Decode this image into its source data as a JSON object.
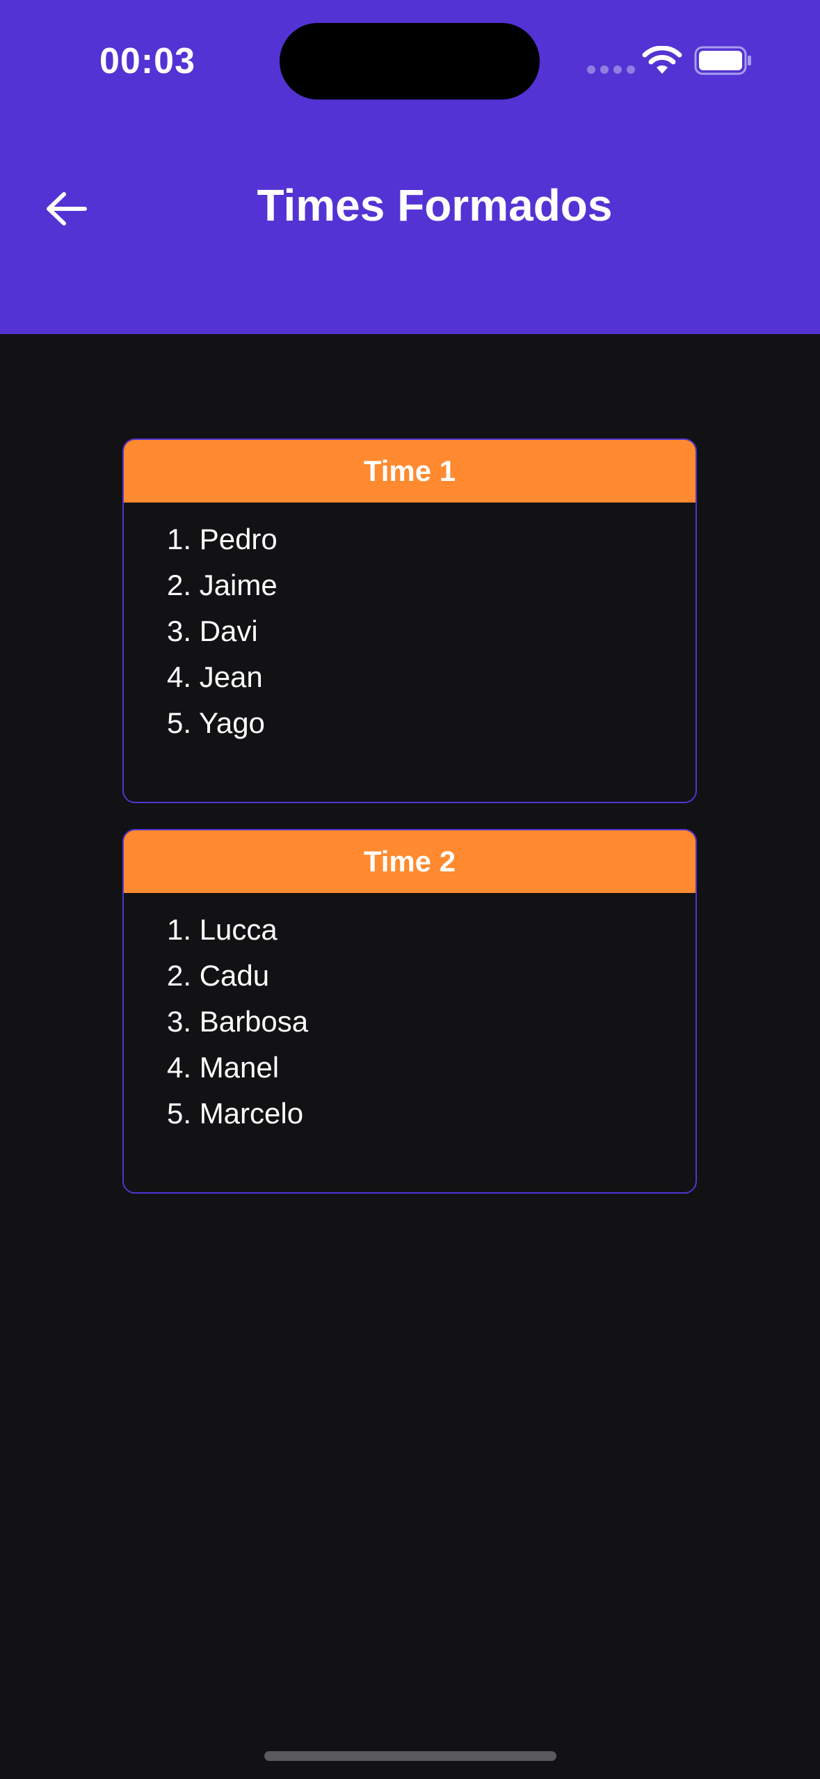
{
  "status_bar": {
    "time": "00:03"
  },
  "header": {
    "title": "Times Formados",
    "back_icon": "arrow-left-icon"
  },
  "colors": {
    "header_bg": "#5333d3",
    "team_header_bg": "#ff8a2f",
    "page_bg": "#121214",
    "card_border": "#5333d3"
  },
  "teams": [
    {
      "name": "Time 1",
      "players": [
        "1. Pedro",
        "2. Jaime",
        "3. Davi",
        "4. Jean",
        "5. Yago"
      ]
    },
    {
      "name": "Time 2",
      "players": [
        "1. Lucca",
        "2. Cadu",
        "3. Barbosa",
        "4. Manel",
        "5. Marcelo"
      ]
    }
  ]
}
